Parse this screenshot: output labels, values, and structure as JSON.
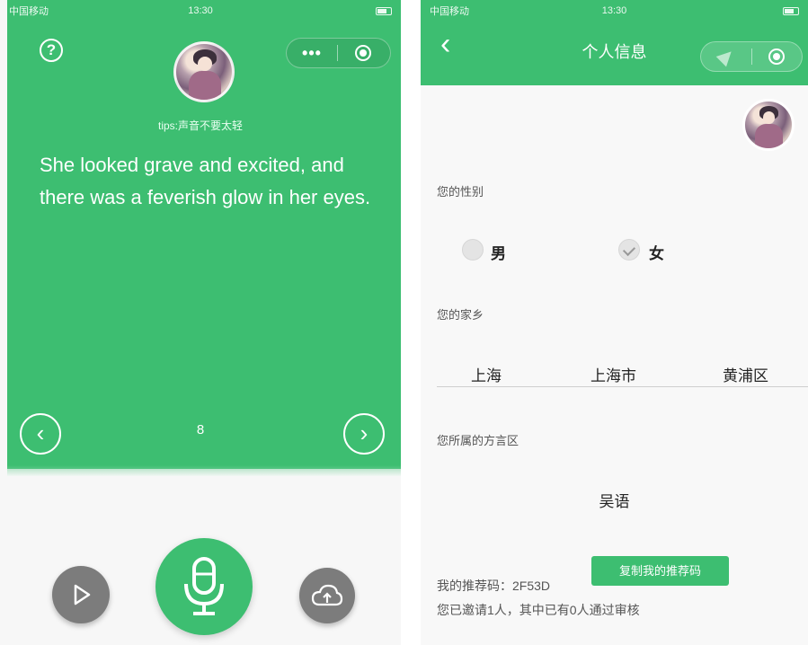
{
  "left_phone": {
    "status": {
      "carrier": "中国移动",
      "time": "13:30"
    },
    "help_icon": "?",
    "capsule": {
      "more": "•••"
    },
    "tips": "tips:声音不要太轻",
    "sentence": "She looked grave and excited, and there was a feverish glow in her eyes.",
    "page_number": "8",
    "prev_glyph": "‹",
    "next_glyph": "›"
  },
  "right_phone": {
    "status": {
      "carrier": "中国移动",
      "time": "13:30"
    },
    "title": "个人信息",
    "back_glyph": "‹",
    "gender": {
      "label": "您的性别",
      "options": [
        {
          "label": "男",
          "checked": false
        },
        {
          "label": "女",
          "checked": true
        }
      ]
    },
    "hometown": {
      "label": "您的家乡",
      "province": "上海",
      "city": "上海市",
      "district": "黄浦区"
    },
    "dialect": {
      "label": "您所属的方言区",
      "value": "吴语"
    },
    "referral": {
      "code_text": "我的推荐码：2F53D",
      "copy_button": "复制我的推荐码",
      "invite_text": "您已邀请1人，其中已有0人通过审核"
    }
  },
  "colors": {
    "accent": "#3dbe71",
    "gray_button": "#7c7c7c",
    "background": "#f7f7f7"
  },
  "icons": [
    "help-icon",
    "more-icon",
    "record-target-icon",
    "chevron-left-icon",
    "chevron-right-icon",
    "play-icon",
    "microphone-icon",
    "upload-cloud-icon",
    "back-icon",
    "location-arrow-icon",
    "check-icon"
  ]
}
